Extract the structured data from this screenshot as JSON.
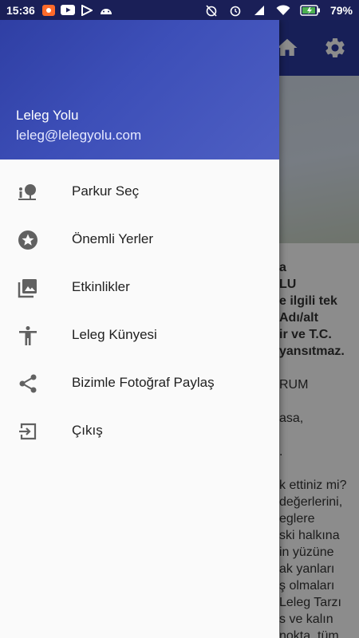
{
  "status_bar": {
    "time": "15:36",
    "battery_percent": "79%"
  },
  "drawer": {
    "header": {
      "name": "Leleg Yolu",
      "email": "leleg@lelegyolu.com"
    },
    "items": [
      {
        "label": "Parkur Seç",
        "icon": "tree-person-icon"
      },
      {
        "label": "Önemli Yerler",
        "icon": "star-circle-icon"
      },
      {
        "label": "Etkinlikler",
        "icon": "photo-library-icon"
      },
      {
        "label": "Leleg Künyesi",
        "icon": "person-icon"
      },
      {
        "label": "Bizimle Fotoğraf Paylaş",
        "icon": "share-icon"
      },
      {
        "label": "Çıkış",
        "icon": "exit-icon"
      }
    ]
  },
  "background_content": {
    "lines": [
      {
        "text": "a",
        "bold": true
      },
      {
        "text": "LU",
        "bold": true
      },
      {
        "text": "e ilgili tek",
        "bold": true
      },
      {
        "text": "Adı/alt",
        "bold": true
      },
      {
        "text": "ir ve T.C.",
        "bold": true
      },
      {
        "text": "yansıtmaz.",
        "bold": true
      },
      {
        "text": "",
        "bold": false
      },
      {
        "text": "RUM",
        "bold": false
      },
      {
        "text": "",
        "bold": false
      },
      {
        "text": "asa,",
        "bold": false
      },
      {
        "text": "",
        "bold": false
      },
      {
        "text": ".",
        "bold": false
      },
      {
        "text": "",
        "bold": false
      },
      {
        "text": "k ettiniz mi?",
        "bold": false
      },
      {
        "text": "değerlerini,",
        "bold": false
      },
      {
        "text": "eglere",
        "bold": false
      },
      {
        "text": "ski halkına",
        "bold": false
      },
      {
        "text": "in yüzüne",
        "bold": false
      },
      {
        "text": "ak yanları",
        "bold": false
      },
      {
        "text": "ş olmaları",
        "bold": false
      },
      {
        "text": "Leleg Tarzı",
        "bold": false
      },
      {
        "text": "s ve kalın",
        "bold": false
      },
      {
        "text": "nokta, tüm",
        "bold": false
      }
    ]
  },
  "colors": {
    "primary": "#2b3a9e",
    "header_gradient_start": "#2f3fa4",
    "header_gradient_end": "#4e5fc3",
    "icon_gray": "#616161"
  }
}
